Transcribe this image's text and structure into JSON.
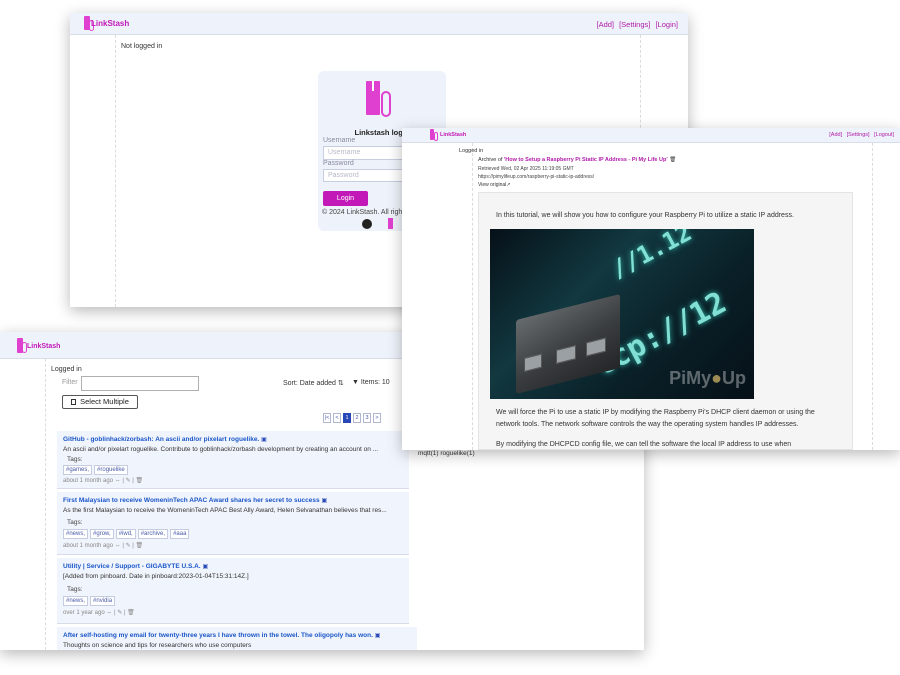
{
  "login_window": {
    "brand": "LinkStash",
    "nav": {
      "add": "[Add]",
      "settings": "[Settings]",
      "login": "[Login]"
    },
    "status": "Not logged in",
    "card": {
      "title": "Linkstash login",
      "username_label": "Username",
      "username_placeholder": "Username",
      "password_label": "Password",
      "password_placeholder": "Password",
      "login_button": "Login"
    },
    "footer": "© 2024 LinkStash. All righ"
  },
  "archive_window": {
    "brand": "LinkStash",
    "nav": {
      "add": "[Add]",
      "settings": "[Settings]",
      "logout": "[Logout]"
    },
    "status": "Logged in",
    "archive_prefix": "Archive of ",
    "archive_title": "'How to Setup a Raspberry Pi Static IP Address - Pi My Life Up'",
    "retrieved": "Retrieved Wed, 02 Apr 2025 11:19:05 GMT",
    "url": "https://pimylifeup.com/raspberry-pi-static-ip-address/",
    "view_original": "View original",
    "para1": "In this tutorial, we will show you how to configure your Raspberry Pi to utilize a static IP address.",
    "image_caption_words": [
      "tcp://12",
      "//1.12",
      "PiMy",
      "Up"
    ],
    "para2_line1": "We will force the Pi to use a static IP by modifying the Raspberry Pi's DHCP client daemon or using the",
    "para2_line2": "network tools. The network software controls the way the operating system handles IP addresses.",
    "para3": "By modifying the DHCPCD config file, we can tell the software the local IP address to use when"
  },
  "list_window": {
    "brand": "LinkStash",
    "status": "Logged in",
    "filter_label": "Filter",
    "sort_label": "Sort: Date added ⇅",
    "items_label": "▼ Items: 10",
    "select_multiple": "Select Multiple",
    "pager": [
      "|<",
      "<",
      "1",
      "2",
      "3",
      ">",
      ">|"
    ],
    "side_tags": "mqtt(1)  roguelike(1)",
    "rows": [
      {
        "title": "GitHub - goblinhack/zorbash: An ascii and/or pixelart roguelike.",
        "desc": "An ascii and/or pixelart roguelike. Contribute to goblinhack/zorbash development by creating an account on ...",
        "tags_label": "Tags:",
        "tags": [
          "#games,",
          "#roguelike"
        ],
        "meta": "about 1 month ago ⇔ | ✎ | 🗑"
      },
      {
        "title": "First Malaysian to receive WomeninTech APAC Award shares her secret to success",
        "desc": "As the first Malaysian to receive the WomeninTech APAC Best Ally Award, Helen Selvanathan believes that res...",
        "tags_label": "Tags:",
        "tags": [
          "#news,",
          "#grow,",
          "#iwd,",
          "#archive,",
          "#aaa"
        ],
        "meta": "about 1 month ago ⇔ | ✎ | 🗑"
      },
      {
        "title": "Utility | Service / Support - GIGABYTE U.S.A.",
        "desc": "[Added from pinboard. Date in pinboard:2023-01-04T15:31:14Z.]",
        "tags_label": "Tags:",
        "tags": [
          "#news,",
          "#nvidia"
        ],
        "meta": "over 1 year ago ⇔ | ✎ | 🗑"
      },
      {
        "title": "After self-hosting my email for twenty-three years I have thrown in the towel. The oligopoly has won.",
        "desc": "Thoughts on science and tips for researchers who use computers",
        "tags_label": "",
        "tags": [],
        "meta": ""
      }
    ]
  },
  "colors": {
    "brand": "#c318b8",
    "logo": "#e040d0",
    "link": "#1a56c8",
    "header_bg": "#eef2fa"
  }
}
